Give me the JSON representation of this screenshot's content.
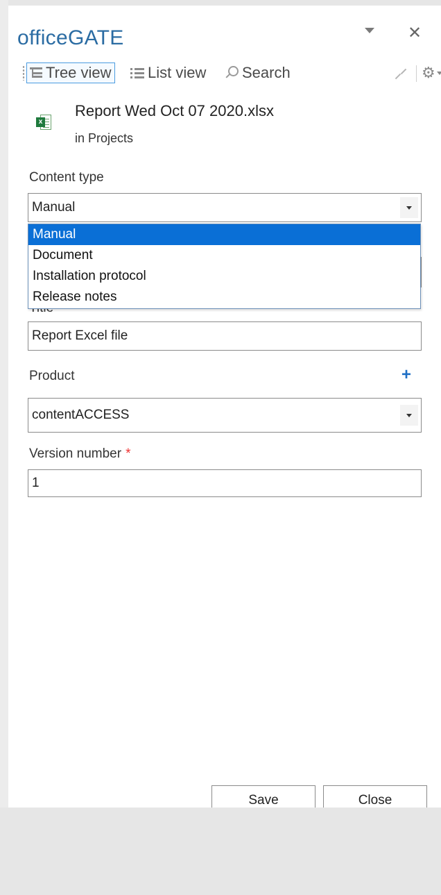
{
  "app": {
    "title": "officeGATE"
  },
  "toolbar": {
    "tree_view": "Tree view",
    "list_view": "List view",
    "search": "Search"
  },
  "file": {
    "name": "Report Wed Oct 07 2020.xlsx",
    "location": "in Projects",
    "icon": "excel-icon",
    "icon_badge": "x"
  },
  "form": {
    "content_type": {
      "label": "Content type",
      "value": "Manual",
      "options": [
        "Manual",
        "Document",
        "Installation protocol",
        "Release notes"
      ],
      "selected_index": 0
    },
    "title": {
      "label": "Title",
      "value": "Report Excel file"
    },
    "product": {
      "label": "Product",
      "value": "contentACCESS",
      "add_icon": "+"
    },
    "version": {
      "label": "Version number",
      "required_mark": "*",
      "value": "1"
    }
  },
  "buttons": {
    "save": "Save",
    "close": "Close"
  },
  "colors": {
    "title": "#2b6ca3",
    "selection": "#0a6fd6",
    "accent_plus": "#1f6fc5",
    "required": "#ee3333"
  }
}
